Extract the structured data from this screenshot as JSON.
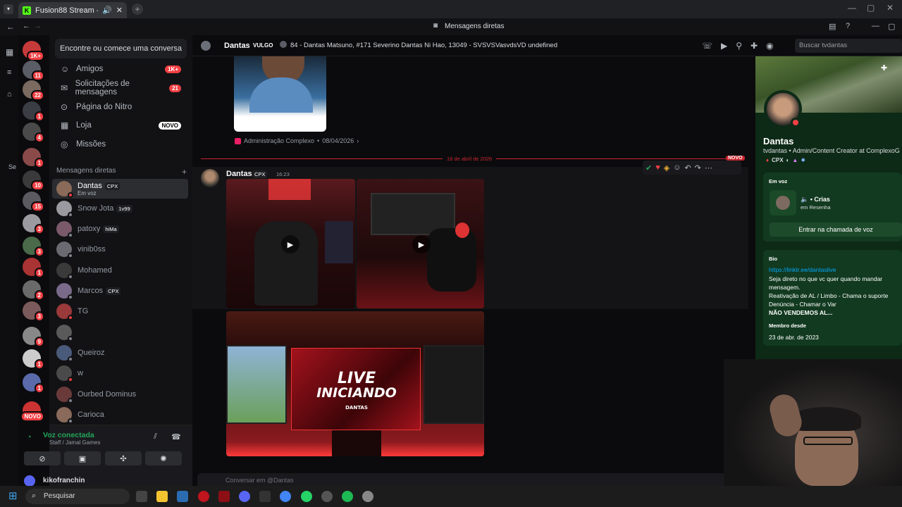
{
  "browser": {
    "tab_title": "Fusion88 Stream - Watch L",
    "tab_favicon": "K",
    "window_title": "Mensagens diretas"
  },
  "dm_panel": {
    "search_placeholder": "Encontre ou comece uma conversa",
    "nav": [
      {
        "label": "Amigos",
        "badge": "1K+",
        "icon": "friends-icon"
      },
      {
        "label": "Solicitações de mensagens",
        "badge": "21",
        "icon": "inbox-icon"
      },
      {
        "label": "Página do Nitro",
        "badge": "",
        "icon": "nitro-icon"
      },
      {
        "label": "Loja",
        "badge": "NOVO",
        "icon": "shop-icon"
      },
      {
        "label": "Missões",
        "badge": "",
        "icon": "quests-icon"
      }
    ],
    "section_label": "Mensagens diretas",
    "add_label": "+",
    "dms": [
      {
        "name": "Dantas",
        "tag": "CPX",
        "sub": "Em voz"
      },
      {
        "name": "Snow Jota",
        "tag": "1v99",
        "sub": ""
      },
      {
        "name": "patoxy",
        "tag": "hiMa",
        "sub": ""
      },
      {
        "name": "vinib0ss",
        "tag": "",
        "sub": ""
      },
      {
        "name": "Mohamed",
        "tag": "",
        "sub": ""
      },
      {
        "name": "Marcos",
        "tag": "CPX",
        "sub": ""
      },
      {
        "name": "TG",
        "tag": "",
        "sub": ""
      },
      {
        "name": "",
        "tag": "",
        "sub": ""
      },
      {
        "name": "Queiroz",
        "tag": "",
        "sub": ""
      },
      {
        "name": "w",
        "tag": "",
        "sub": ""
      },
      {
        "name": "Ourbed Dominus",
        "tag": "",
        "sub": ""
      },
      {
        "name": "Carioca",
        "tag": "",
        "sub": ""
      }
    ]
  },
  "voice": {
    "status": "Voz conectada",
    "channel": "Staff / Jamal Games"
  },
  "user": {
    "name": "kikofranchin"
  },
  "server_badges": [
    "1K+",
    "11",
    "22",
    "1",
    "4",
    "1",
    "10",
    "15",
    "3",
    "3",
    "1",
    "2",
    "3",
    "9",
    "1",
    "1",
    "NOVO"
  ],
  "header": {
    "name": "Dantas",
    "vulgo": "VULGO",
    "status": "84 - Dantas Matsuno, #171 Severino Dantas Ni Hao, 13049 - SVSVSVasvdsVD undefined",
    "search_placeholder": "Buscar tvdantas"
  },
  "chat": {
    "embed_source": "Administração Complexo",
    "embed_date": "08/04/2026",
    "divider_date": "18 de abril de 2026",
    "divider_new": "NOVO",
    "message": {
      "author": "Dantas",
      "tag": "CPX",
      "time": "16:23"
    },
    "media_live_text": "LIVE",
    "media_starting_text": "INICIANDO",
    "media_brand": "DANTAS",
    "composer_placeholder": "Conversar em @Dantas"
  },
  "profile": {
    "name": "Dantas",
    "username": "tvdantas",
    "headline": "Admin/Content Creator at ComplexoG",
    "badge_tag": "CPX",
    "voice_label": "Em voz",
    "voice_channel": "Crias",
    "voice_server": "em Resenha",
    "voice_button": "Entrar na chamada de voz",
    "bio_label": "Bio",
    "bio_link": "https://linktr.ee/dantaslive",
    "bio_lines": [
      "Seja direto no que vc quer quando mandar",
      "mensagem.",
      "Reativação de AL / Limbo - Chama o suporte",
      "Denúncia - Chamar o Var"
    ],
    "bio_bold": "NÃO VENDEMOS AL...",
    "member_since_label": "Membro desde",
    "member_since": "23 de abr. de 2023"
  },
  "taskbar": {
    "search_label": "Pesquisar"
  }
}
